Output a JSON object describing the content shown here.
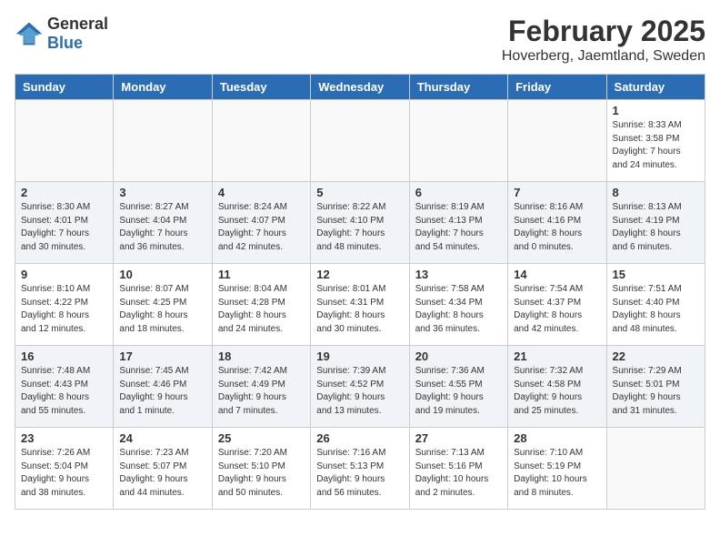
{
  "header": {
    "logo_general": "General",
    "logo_blue": "Blue",
    "main_title": "February 2025",
    "subtitle": "Hoverberg, Jaemtland, Sweden"
  },
  "days_of_week": [
    "Sunday",
    "Monday",
    "Tuesday",
    "Wednesday",
    "Thursday",
    "Friday",
    "Saturday"
  ],
  "weeks": [
    [
      {
        "day": "",
        "info": ""
      },
      {
        "day": "",
        "info": ""
      },
      {
        "day": "",
        "info": ""
      },
      {
        "day": "",
        "info": ""
      },
      {
        "day": "",
        "info": ""
      },
      {
        "day": "",
        "info": ""
      },
      {
        "day": "1",
        "info": "Sunrise: 8:33 AM\nSunset: 3:58 PM\nDaylight: 7 hours\nand 24 minutes."
      }
    ],
    [
      {
        "day": "2",
        "info": "Sunrise: 8:30 AM\nSunset: 4:01 PM\nDaylight: 7 hours\nand 30 minutes."
      },
      {
        "day": "3",
        "info": "Sunrise: 8:27 AM\nSunset: 4:04 PM\nDaylight: 7 hours\nand 36 minutes."
      },
      {
        "day": "4",
        "info": "Sunrise: 8:24 AM\nSunset: 4:07 PM\nDaylight: 7 hours\nand 42 minutes."
      },
      {
        "day": "5",
        "info": "Sunrise: 8:22 AM\nSunset: 4:10 PM\nDaylight: 7 hours\nand 48 minutes."
      },
      {
        "day": "6",
        "info": "Sunrise: 8:19 AM\nSunset: 4:13 PM\nDaylight: 7 hours\nand 54 minutes."
      },
      {
        "day": "7",
        "info": "Sunrise: 8:16 AM\nSunset: 4:16 PM\nDaylight: 8 hours\nand 0 minutes."
      },
      {
        "day": "8",
        "info": "Sunrise: 8:13 AM\nSunset: 4:19 PM\nDaylight: 8 hours\nand 6 minutes."
      }
    ],
    [
      {
        "day": "9",
        "info": "Sunrise: 8:10 AM\nSunset: 4:22 PM\nDaylight: 8 hours\nand 12 minutes."
      },
      {
        "day": "10",
        "info": "Sunrise: 8:07 AM\nSunset: 4:25 PM\nDaylight: 8 hours\nand 18 minutes."
      },
      {
        "day": "11",
        "info": "Sunrise: 8:04 AM\nSunset: 4:28 PM\nDaylight: 8 hours\nand 24 minutes."
      },
      {
        "day": "12",
        "info": "Sunrise: 8:01 AM\nSunset: 4:31 PM\nDaylight: 8 hours\nand 30 minutes."
      },
      {
        "day": "13",
        "info": "Sunrise: 7:58 AM\nSunset: 4:34 PM\nDaylight: 8 hours\nand 36 minutes."
      },
      {
        "day": "14",
        "info": "Sunrise: 7:54 AM\nSunset: 4:37 PM\nDaylight: 8 hours\nand 42 minutes."
      },
      {
        "day": "15",
        "info": "Sunrise: 7:51 AM\nSunset: 4:40 PM\nDaylight: 8 hours\nand 48 minutes."
      }
    ],
    [
      {
        "day": "16",
        "info": "Sunrise: 7:48 AM\nSunset: 4:43 PM\nDaylight: 8 hours\nand 55 minutes."
      },
      {
        "day": "17",
        "info": "Sunrise: 7:45 AM\nSunset: 4:46 PM\nDaylight: 9 hours\nand 1 minute."
      },
      {
        "day": "18",
        "info": "Sunrise: 7:42 AM\nSunset: 4:49 PM\nDaylight: 9 hours\nand 7 minutes."
      },
      {
        "day": "19",
        "info": "Sunrise: 7:39 AM\nSunset: 4:52 PM\nDaylight: 9 hours\nand 13 minutes."
      },
      {
        "day": "20",
        "info": "Sunrise: 7:36 AM\nSunset: 4:55 PM\nDaylight: 9 hours\nand 19 minutes."
      },
      {
        "day": "21",
        "info": "Sunrise: 7:32 AM\nSunset: 4:58 PM\nDaylight: 9 hours\nand 25 minutes."
      },
      {
        "day": "22",
        "info": "Sunrise: 7:29 AM\nSunset: 5:01 PM\nDaylight: 9 hours\nand 31 minutes."
      }
    ],
    [
      {
        "day": "23",
        "info": "Sunrise: 7:26 AM\nSunset: 5:04 PM\nDaylight: 9 hours\nand 38 minutes."
      },
      {
        "day": "24",
        "info": "Sunrise: 7:23 AM\nSunset: 5:07 PM\nDaylight: 9 hours\nand 44 minutes."
      },
      {
        "day": "25",
        "info": "Sunrise: 7:20 AM\nSunset: 5:10 PM\nDaylight: 9 hours\nand 50 minutes."
      },
      {
        "day": "26",
        "info": "Sunrise: 7:16 AM\nSunset: 5:13 PM\nDaylight: 9 hours\nand 56 minutes."
      },
      {
        "day": "27",
        "info": "Sunrise: 7:13 AM\nSunset: 5:16 PM\nDaylight: 10 hours\nand 2 minutes."
      },
      {
        "day": "28",
        "info": "Sunrise: 7:10 AM\nSunset: 5:19 PM\nDaylight: 10 hours\nand 8 minutes."
      },
      {
        "day": "",
        "info": ""
      }
    ]
  ]
}
